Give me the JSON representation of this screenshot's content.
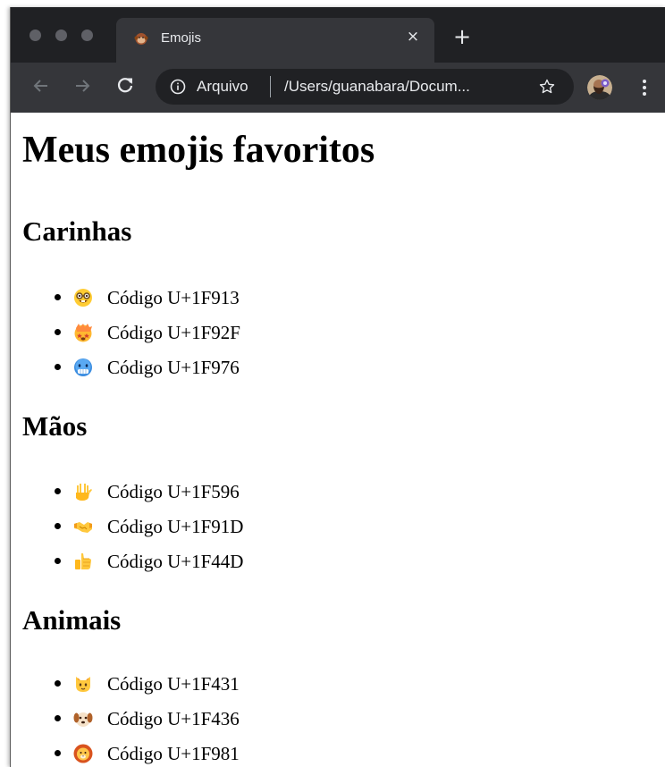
{
  "browser": {
    "tab_title": "Emojis",
    "tab_close_glyph": "×",
    "new_tab_glyph": "+",
    "omnibox_scheme": "Arquivo",
    "omnibox_path": "/Users/guanabara/Docum...",
    "colors": {
      "titlebar": "#202124",
      "toolbar": "#35363a",
      "text": "#e8eaed"
    }
  },
  "page": {
    "title": "Meus emojis favoritos",
    "sections": [
      {
        "heading": "Carinhas",
        "items": [
          {
            "emoji": "nerd-face-icon",
            "text": "Código U+1F913"
          },
          {
            "emoji": "star-struck-face-icon",
            "text": "Código U+1F92F"
          },
          {
            "emoji": "cold-face-icon",
            "text": "Código U+1F976"
          }
        ]
      },
      {
        "heading": "Mãos",
        "items": [
          {
            "emoji": "vulcan-salute-icon",
            "text": "Código U+1F596"
          },
          {
            "emoji": "handshake-icon",
            "text": "Código U+1F91D"
          },
          {
            "emoji": "thumbs-up-icon",
            "text": "Código U+1F44D"
          }
        ]
      },
      {
        "heading": "Animais",
        "items": [
          {
            "emoji": "cat-face-icon",
            "text": "Código U+1F431"
          },
          {
            "emoji": "dog-face-icon",
            "text": "Código U+1F436"
          },
          {
            "emoji": "lion-face-icon",
            "text": "Código U+1F981"
          }
        ]
      }
    ]
  }
}
